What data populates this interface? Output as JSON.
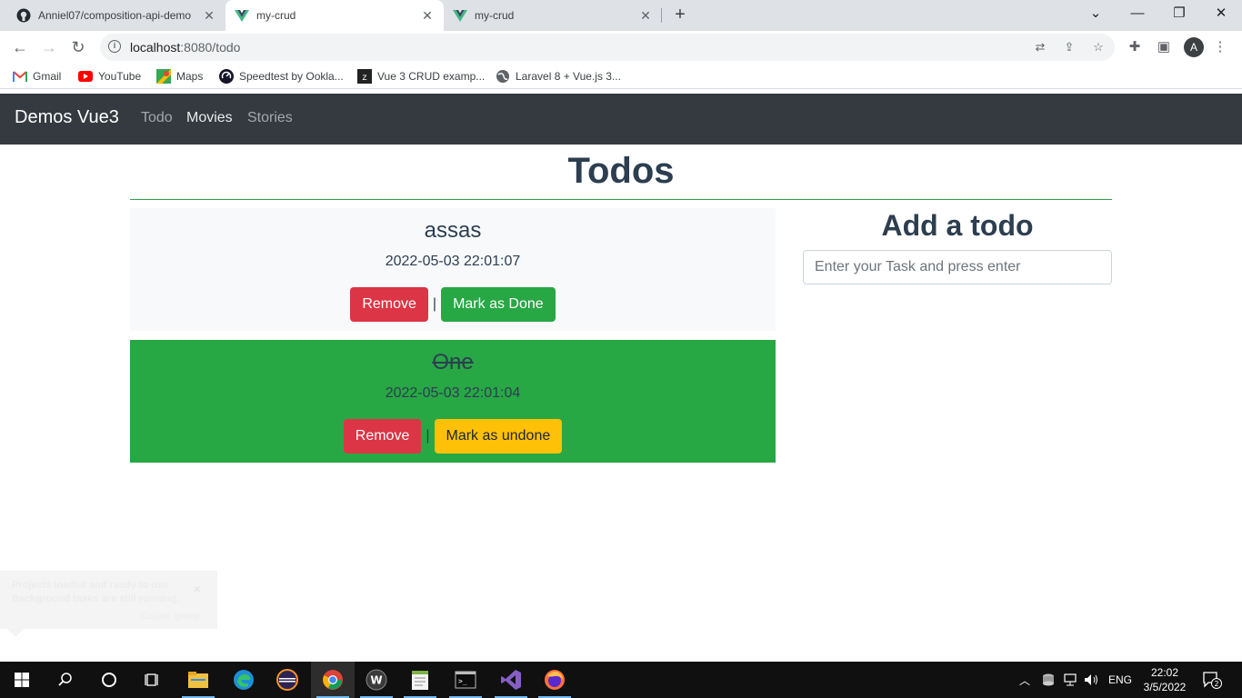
{
  "browser": {
    "tabs": [
      {
        "title": "Anniel07/composition-api-demo",
        "favicon": "github-icon",
        "active": false
      },
      {
        "title": "my-crud",
        "favicon": "vue-icon",
        "active": true
      },
      {
        "title": "my-crud",
        "favicon": "vue-icon",
        "active": false
      }
    ],
    "url_host": "localhost",
    "url_path": ":8080/todo",
    "profile_initial": "A",
    "bookmarks": [
      {
        "label": "Gmail",
        "icon": "gmail-icon"
      },
      {
        "label": "YouTube",
        "icon": "youtube-icon"
      },
      {
        "label": "Maps",
        "icon": "maps-icon"
      },
      {
        "label": "Speedtest by Ookla...",
        "icon": "speedtest-icon"
      },
      {
        "label": "Vue 3 CRUD examp...",
        "icon": "vue-crud-icon"
      },
      {
        "label": "Laravel 8 + Vue.js 3...",
        "icon": "globe-icon"
      }
    ]
  },
  "app": {
    "brand": "Demos Vue3",
    "nav": [
      "Todo",
      "Movies",
      "Stories"
    ],
    "page_title": "Todos",
    "todos": [
      {
        "task": "assas",
        "timestamp": "2022-05-03 22:01:07",
        "remove_label": "Remove",
        "separator": "|",
        "toggle_label": "Mark as Done",
        "done": false
      },
      {
        "task": "One",
        "timestamp": "2022-05-03 22:01:04",
        "remove_label": "Remove",
        "separator": "|",
        "toggle_label": "Mark as undone",
        "done": true
      }
    ],
    "add_title": "Add a todo",
    "add_placeholder": "Enter your Task and press enter",
    "colors": {
      "navbar": "#343a40",
      "done": "#28a745",
      "danger": "#dc3545",
      "warning": "#ffc107",
      "pending_bg": "#f8f9fa"
    }
  },
  "toast": {
    "line1": "Projects loaded and ready to use",
    "line2": "Background tasks are still running.",
    "link": "Ocultar ignorar"
  },
  "taskbar": {
    "language": "ENG",
    "time": "22:02",
    "date": "3/5/2022",
    "notifications": "2"
  }
}
